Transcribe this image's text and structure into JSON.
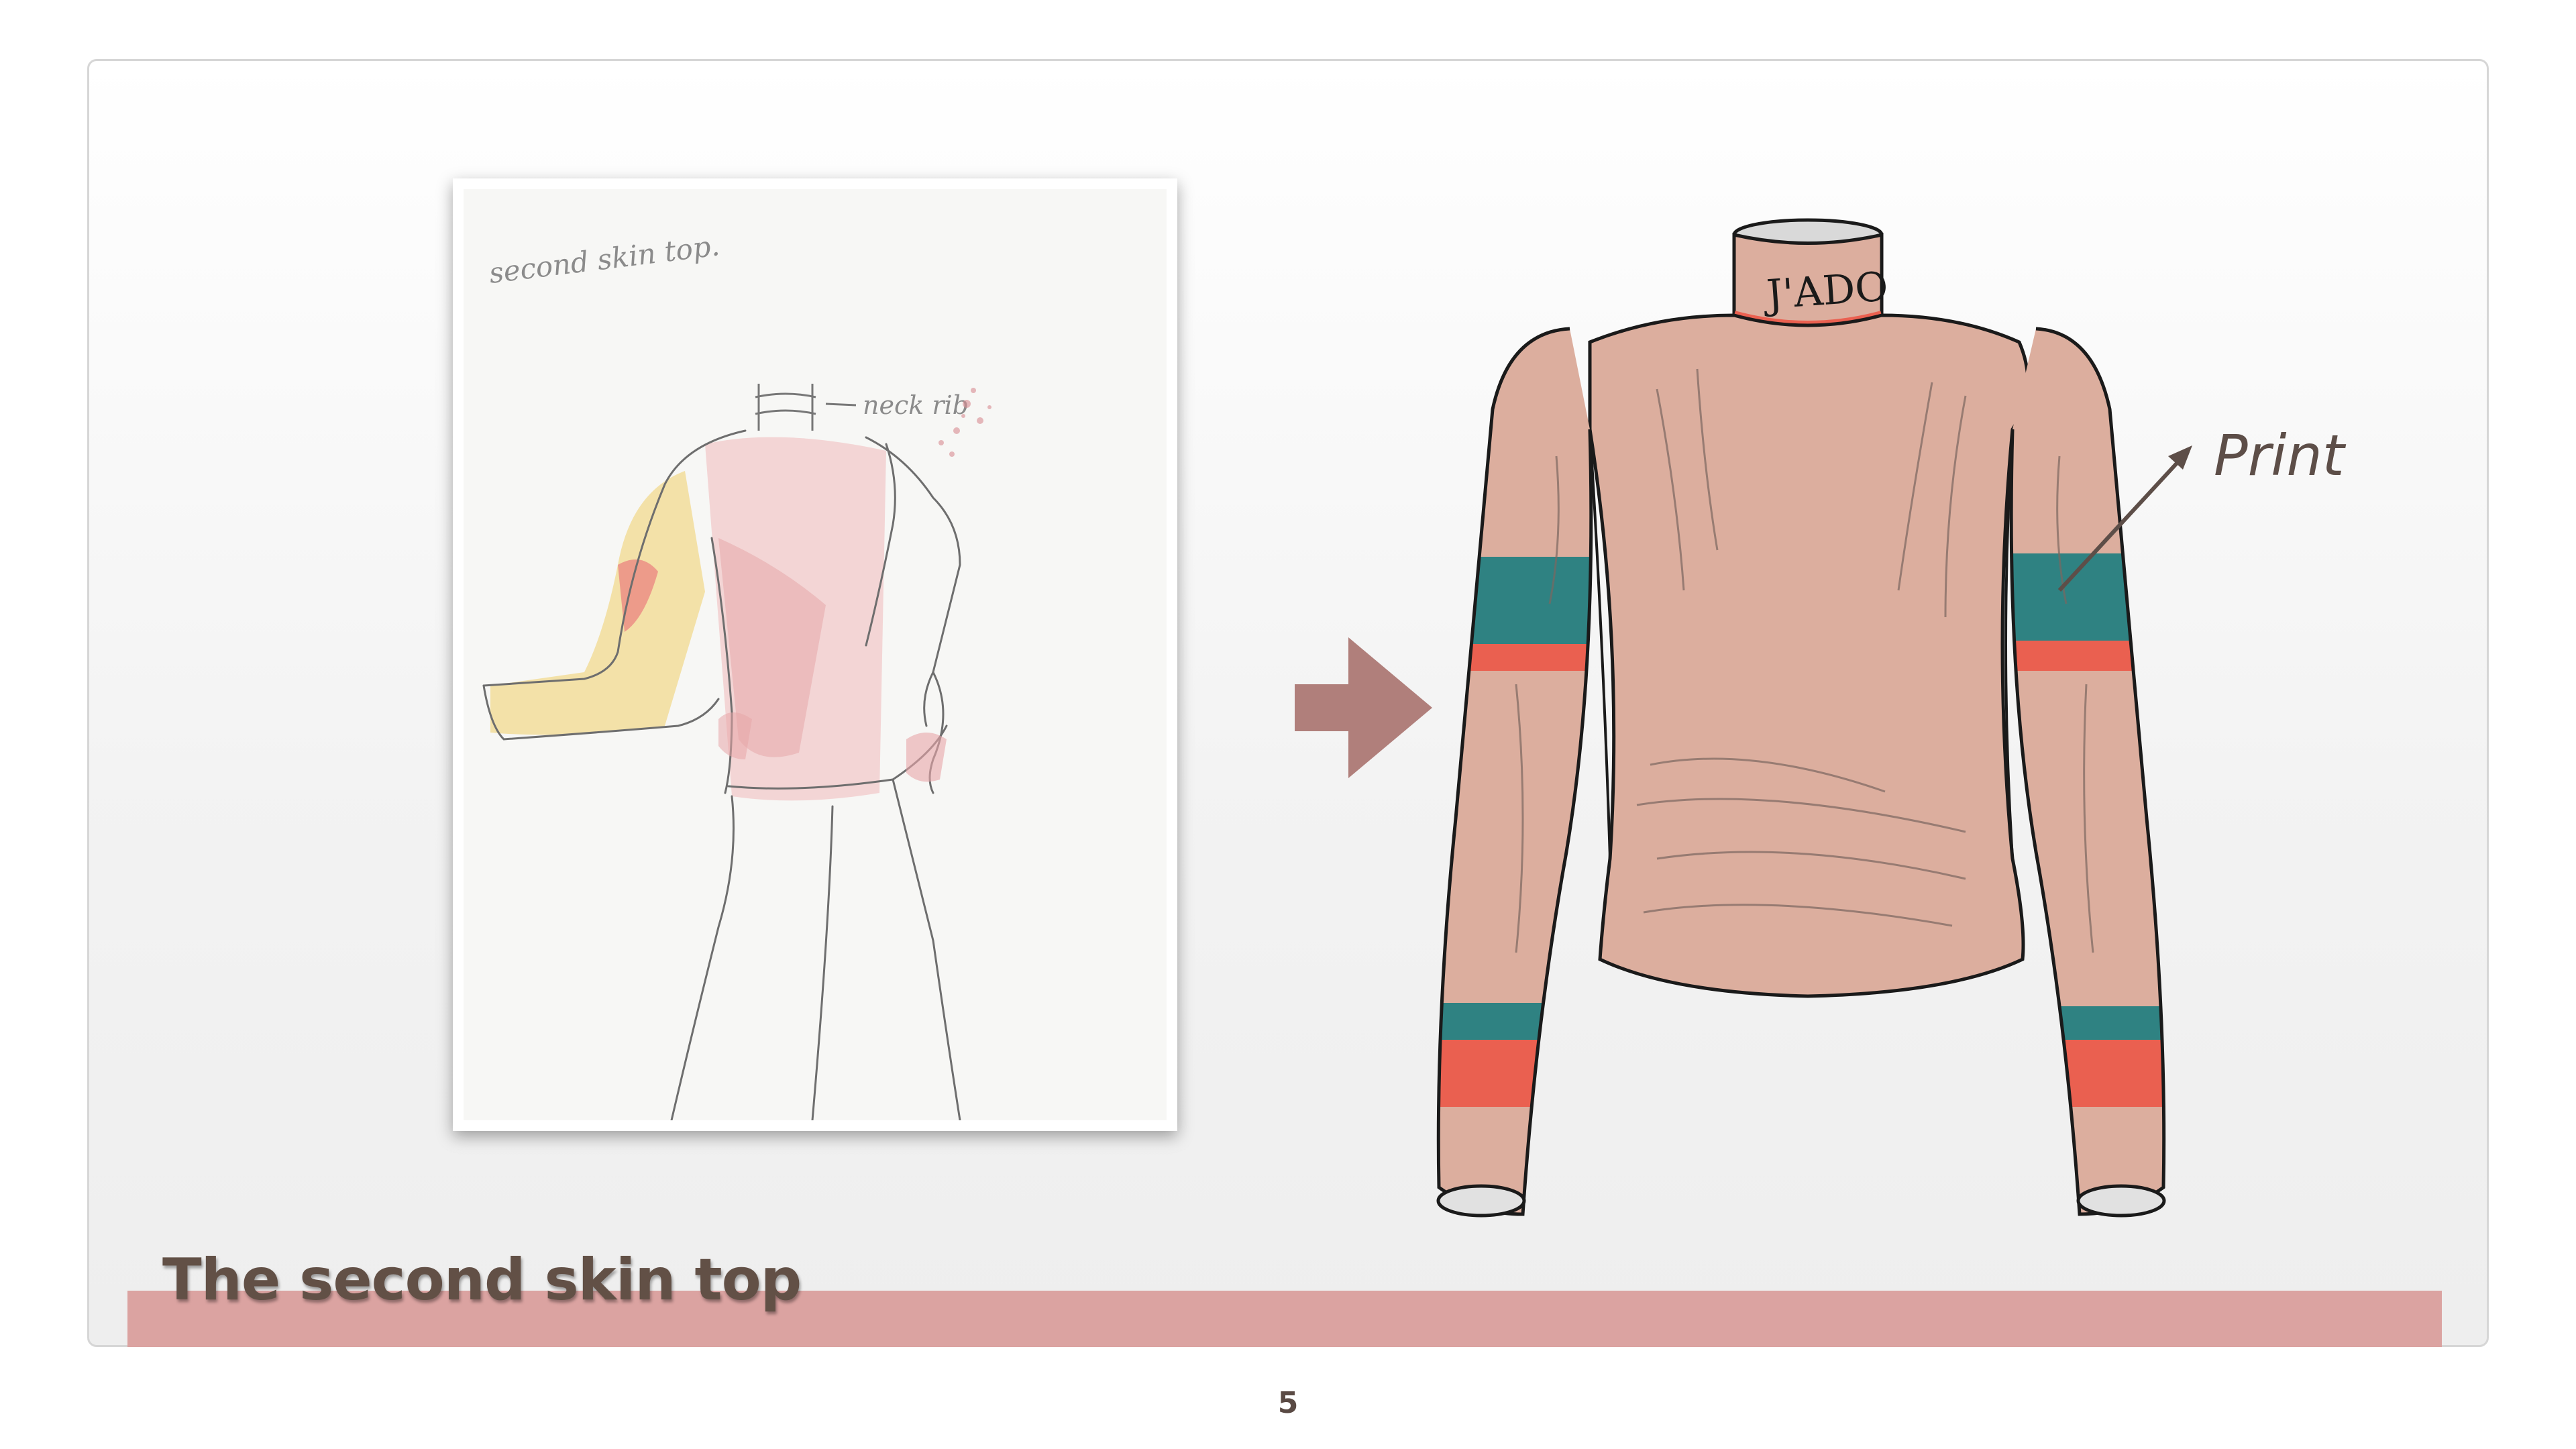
{
  "slide": {
    "title": "The second skin top",
    "page_number": "5"
  },
  "sketch": {
    "handwritten_title": "second skin top.",
    "handwritten_annotation": "neck rib"
  },
  "garment": {
    "collar_print_text": "J'ADO"
  },
  "callout": {
    "label": "Print"
  },
  "colors": {
    "garment_base": "#dcae9e",
    "teal_stripe": "#2f8282",
    "coral_stripe": "#ea6050",
    "title_bar": "#dba3a1",
    "arrow": "#b07f7b",
    "text": "#625046"
  },
  "icons": [
    "right-arrow-icon",
    "callout-arrow-icon"
  ]
}
